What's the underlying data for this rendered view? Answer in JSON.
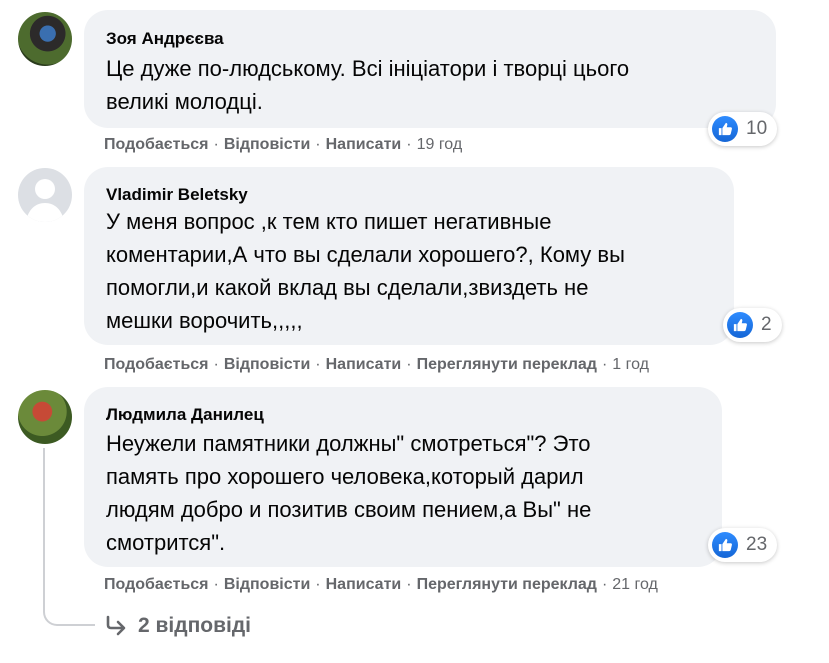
{
  "comments": [
    {
      "author": "Зоя Андрєєва",
      "text": "Це дуже по-людському. Всі ініціатори і творці цього\nвеликі молодці.",
      "likes": "10",
      "actions": [
        "Подобається",
        "Відповісти",
        "Написати"
      ],
      "time": "19 год"
    },
    {
      "author": "Vladimir Beletsky",
      "text": "У меня вопрос ,к тем кто пишет негативные\nкоментарии,А что вы сделали хорошего?, Кому вы\nпомогли,и какой вклад вы сделали,звиздеть не\nмешки ворочить,,,,,",
      "likes": "2",
      "actions": [
        "Подобається",
        "Відповісти",
        "Написати",
        "Переглянути переклад"
      ],
      "time": "1 год"
    },
    {
      "author": "Людмила Данилец",
      "text": "Неужели памятники должны\" смотреться\"? Это\nпамять про хорошего человека,который дарил\nлюдям добро и позитив своим пением,а Вы\" не\nсмотрится\".",
      "likes": "23",
      "actions": [
        "Подобається",
        "Відповісти",
        "Написати",
        "Переглянути переклад"
      ],
      "time": "21 год"
    }
  ],
  "replies_link": "2 відповіді",
  "colors": {
    "bubble": "#f0f2f5",
    "meta": "#65676b",
    "like": "#1877f2"
  },
  "icons": [
    "like-icon",
    "reply-arrow-icon",
    "default-avatar-icon"
  ]
}
